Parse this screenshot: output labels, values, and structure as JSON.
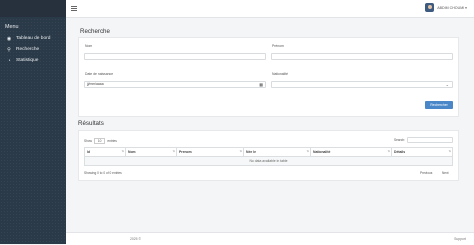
{
  "sidebar": {
    "menu_title": "Menu",
    "items": [
      {
        "label": "Tableau de bord",
        "icon": "dashboard-icon",
        "glyph": "◉"
      },
      {
        "label": "Recherche",
        "icon": "search-icon",
        "glyph": "⚲"
      },
      {
        "label": "Statistique",
        "icon": "stats-icon",
        "glyph": "◔"
      }
    ]
  },
  "topbar": {
    "user_name": "ABDIM CHOUMI ▾"
  },
  "search": {
    "title": "Recherche",
    "nom_label": "Nom",
    "prenom_label": "Prénom",
    "dob_label": "Date de naissance",
    "dob_placeholder": "jj/mm/aaaa",
    "nationalite_label": "Nationalité",
    "button": "Rechercher"
  },
  "results": {
    "title": "Résultats",
    "show_prefix": "Show",
    "entries_value": "10",
    "show_suffix": "entries",
    "search_label": "Search:",
    "columns": [
      "Id",
      "Nom",
      "Prenom",
      "Née le",
      "Nationalité",
      "Détails"
    ],
    "empty": "No data available in table",
    "info": "Showing 0 to 0 of 0 entries",
    "prev": "Previous",
    "next": "Next"
  },
  "footer": {
    "left": "2025 ©",
    "right": "Support"
  }
}
